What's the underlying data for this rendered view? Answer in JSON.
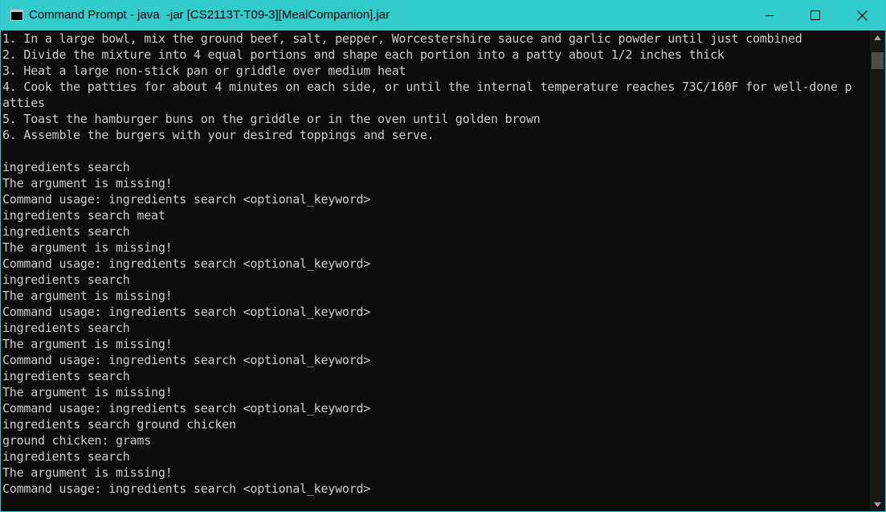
{
  "window": {
    "title": "Command Prompt - java  -jar [CS2113T-T09-3][MealCompanion].jar"
  },
  "icons": {
    "app": "command-prompt-icon",
    "minimize": "minimize-icon",
    "maximize": "maximize-icon",
    "close": "close-icon",
    "scroll_up": "chevron-up-icon",
    "scroll_down": "chevron-down-icon"
  },
  "console": {
    "lines": [
      "1. In a large bowl, mix the ground beef, salt, pepper, Worcestershire sauce and garlic powder until just combined",
      "2. Divide the mixture into 4 equal portions and shape each portion into a patty about 1/2 inches thick",
      "3. Heat a large non-stick pan or griddle over medium heat",
      "4. Cook the patties for about 4 minutes on each side, or until the internal temperature reaches 73C/160F for well-done p",
      "atties",
      "5. Toast the hamburger buns on the griddle or in the oven until golden brown",
      "6. Assemble the burgers with your desired toppings and serve.",
      "",
      "ingredients search",
      "The argument is missing!",
      "Command usage: ingredients search <optional_keyword>",
      "ingredients search meat",
      "ingredients search",
      "The argument is missing!",
      "Command usage: ingredients search <optional_keyword>",
      "ingredients search",
      "The argument is missing!",
      "Command usage: ingredients search <optional_keyword>",
      "ingredients search",
      "The argument is missing!",
      "Command usage: ingredients search <optional_keyword>",
      "ingredients search",
      "The argument is missing!",
      "Command usage: ingredients search <optional_keyword>",
      "ingredients search ground chicken",
      "ground chicken: grams",
      "ingredients search",
      "The argument is missing!",
      "Command usage: ingredients search <optional_keyword>"
    ]
  },
  "colors": {
    "titlebar": "#33cccc",
    "console_bg": "#0c0c0c",
    "console_text": "#cccccc"
  }
}
